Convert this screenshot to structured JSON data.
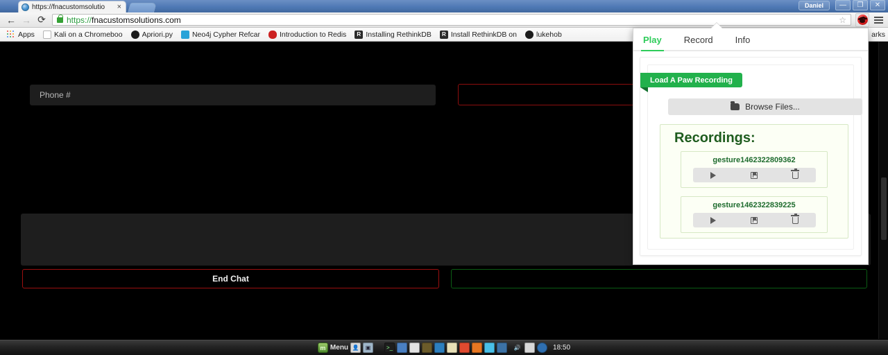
{
  "browser": {
    "user_chip": "Daniel",
    "tab": {
      "title": "https://fnacustomsolutio",
      "close_label": "×",
      "favicon": "globe-icon"
    },
    "window_controls": {
      "minimize": "—",
      "maximize": "❐",
      "close": "✕"
    },
    "nav": {
      "back": "←",
      "forward": "→",
      "reload": "⟳"
    },
    "omnibox": {
      "scheme": "https://",
      "host": "fnacustomsolutions.com",
      "full_url": "https://fnacustomsolutions.com",
      "lock": "lock-icon",
      "star": "☆"
    },
    "extension_icon": "paw-icon",
    "menu_icon": "hamburger-icon",
    "bookmarks": [
      {
        "label": "Apps",
        "icon": "apps-grid-icon"
      },
      {
        "label": "Kali on a Chromeboo",
        "icon": "page-icon"
      },
      {
        "label": "Apriori.py",
        "icon": "github-icon"
      },
      {
        "label": "Neo4j Cypher Refcar",
        "icon": "neo4j-icon"
      },
      {
        "label": "Introduction to Redis",
        "icon": "redis-icon"
      },
      {
        "label": "Installing RethinkDB",
        "icon": "rethinkdb-icon"
      },
      {
        "label": "Install RethinkDB on",
        "icon": "rethinkdb-icon"
      },
      {
        "label": "lukehob",
        "icon": "github-icon"
      }
    ],
    "other_bookmarks": "arks"
  },
  "page": {
    "phone_field": {
      "placeholder": "Phone #",
      "value": ""
    },
    "right_field": {
      "placeholder": "",
      "value": ""
    },
    "chat_log": {
      "value": ""
    },
    "end_chat_button": "End Chat",
    "send_button": ""
  },
  "popup": {
    "tabs": [
      {
        "label": "Play",
        "active": true
      },
      {
        "label": "Record",
        "active": false
      },
      {
        "label": "Info",
        "active": false
      }
    ],
    "ribbon_label": "Load A Paw Recording",
    "browse_button": {
      "label": "Browse Files...",
      "icon": "folder-icon"
    },
    "recordings_title": "Recordings:",
    "recordings": [
      {
        "name": "gesture1462322809362",
        "actions": [
          {
            "name": "play-icon",
            "label": ""
          },
          {
            "name": "save-icon",
            "label": ""
          },
          {
            "name": "trash-icon",
            "label": ""
          }
        ]
      },
      {
        "name": "gesture1462322839225",
        "actions": [
          {
            "name": "play-icon",
            "label": ""
          },
          {
            "name": "save-icon",
            "label": ""
          },
          {
            "name": "trash-icon",
            "label": ""
          }
        ]
      }
    ],
    "accent_color": "#2ecc5a",
    "ribbon_color": "#22b14c"
  },
  "taskbar": {
    "menu_label": "Menu",
    "clock": "18:50",
    "apps": [
      {
        "name": "terminal-icon",
        "color": "#1d1d1d"
      },
      {
        "name": "files-icon",
        "color": "#4a7fc1"
      },
      {
        "name": "text-editor-icon",
        "color": "#d8d8d8"
      },
      {
        "name": "monitor-icon",
        "color": "#6b5b2a"
      },
      {
        "name": "media-icon",
        "color": "#2d7fbe"
      },
      {
        "name": "notes-icon",
        "color": "#e8e0b8"
      },
      {
        "name": "chrome-icon",
        "color": "#e04a2f"
      },
      {
        "name": "firefox-icon",
        "color": "#e87722"
      },
      {
        "name": "vm-icon",
        "color": "#49c0e8"
      },
      {
        "name": "python-icon",
        "color": "#3c72a5"
      }
    ],
    "tray": [
      {
        "name": "volume-icon"
      },
      {
        "name": "battery-icon"
      },
      {
        "name": "shield-icon"
      }
    ]
  }
}
